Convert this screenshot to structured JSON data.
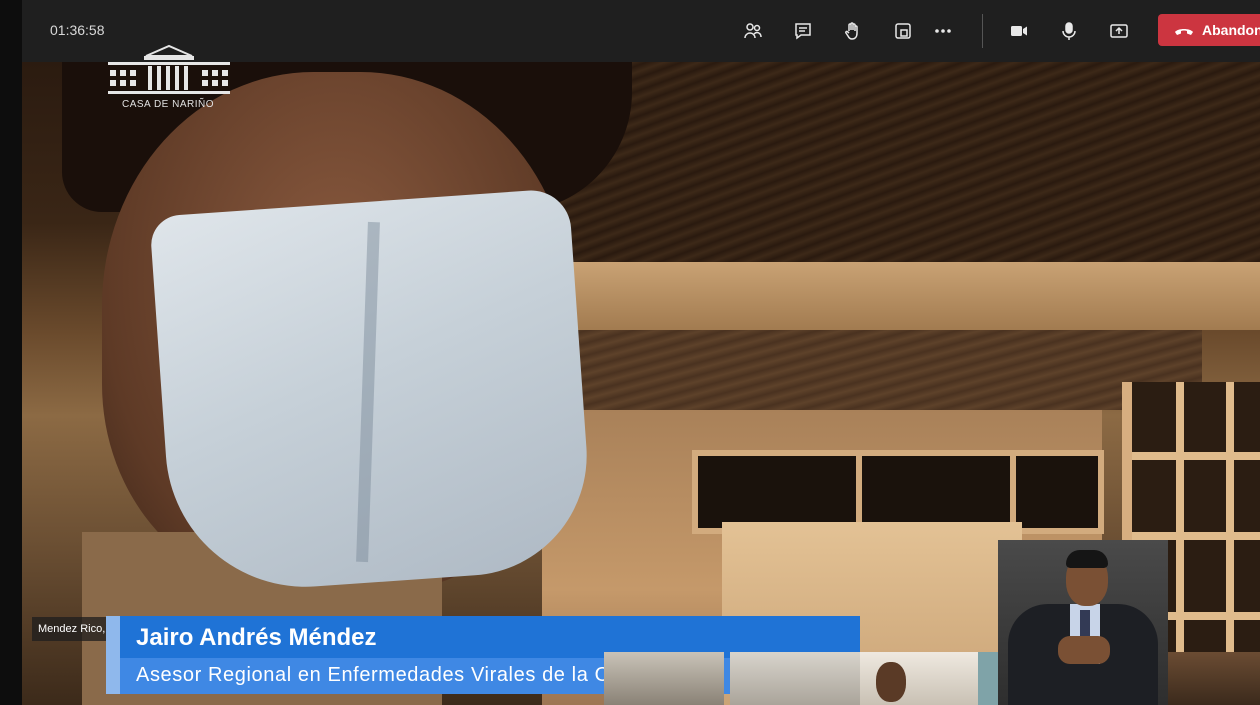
{
  "call": {
    "elapsed_time": "01:36:58",
    "toolbar": {
      "icons": [
        "people-icon",
        "chat-icon",
        "raise-hand-icon",
        "rooms-icon",
        "more-options-icon",
        "camera-icon",
        "microphone-icon",
        "share-screen-icon"
      ],
      "leave_label": "Abandonar"
    }
  },
  "video": {
    "logo_text": "CASA DE NARIÑO",
    "participant_tag": "Mendez Rico, Dr.",
    "lower_third": {
      "name": "Jairo Andrés Méndez",
      "title": "Asesor Regional en Enfermedades Virales de la OPS/OMS"
    }
  },
  "colors": {
    "leave_button": "#cc3540",
    "lower_third_name_bg": "#1f73d6",
    "lower_third_title_bg": "#3f88e4",
    "topbar_bg": "#1f1f1f"
  }
}
